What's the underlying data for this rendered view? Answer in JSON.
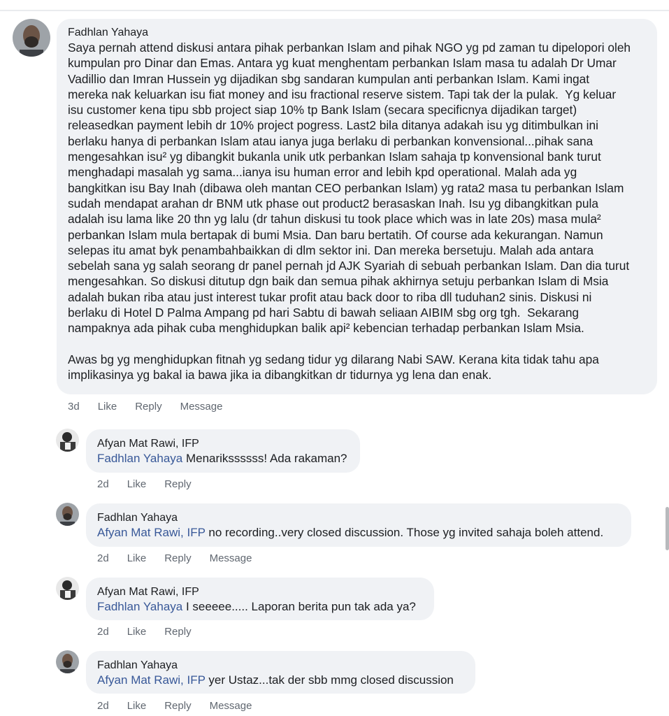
{
  "main_comment": {
    "author": "Fadhlan Yahaya",
    "lines": [
      "Saya pernah attend diskusi antara pihak perbankan Islam and pihak NGO yg pd zaman tu dipelopori oleh",
      "kumpulan pro Dinar dan Emas. Antara yg kuat menghentam perbankan Islam masa tu adalah Dr Umar",
      "Vadillio dan Imran Hussein yg dijadikan sbg sandaran kumpulan anti perbankan Islam. Kami ingat",
      "mereka nak keluarkan isu fiat money and isu fractional reserve sistem. Tapi tak der la pulak.  Yg keluar",
      "isu customer kena tipu sbb project siap 10% tp Bank Islam (secara specificnya dijadikan target)",
      "releasedkan payment lebih dr 10% project pogress. Last2 bila ditanya adakah isu yg ditimbulkan ini",
      "berlaku hanya di perbankan Islam atau ianya juga berlaku di perbankan konvensional...pihak sana",
      "mengesahkan isu² yg dibangkit bukanla unik utk perbankan Islam sahaja tp konvensional bank turut",
      "menghadapi masalah yg sama...ianya isu human error and lebih kpd operational. Malah ada yg",
      "bangkitkan isu Bay Inah (dibawa oleh mantan CEO perbankan Islam) yg rata2 masa tu perbankan Islam",
      "sudah mendapat arahan dr BNM utk phase out product2 berasaskan Inah. Isu yg dibangkitkan pula",
      "adalah isu lama like 20 thn yg lalu (dr tahun diskusi tu took place which was in late 20s) masa mula²",
      "perbankan Islam mula bertapak di bumi Msia. Dan baru bertatih. Of course ada kekurangan. Namun",
      "selepas itu amat byk penambahbaikkan di dlm sektor ini. Dan mereka bersetuju. Malah ada antara",
      "sebelah sana yg salah seorang dr panel pernah jd AJK Syariah di sebuah perbankan Islam. Dan dia turut",
      "mengesahkan. So diskusi ditutup dgn baik dan semua pihak akhirnya setuju perbankan Islam di Msia",
      "adalah bukan riba atau just interest tukar profit atau back door to riba dll tuduhan2 sinis. Diskusi ni",
      "berlaku di Hotel D Palma Ampang pd hari Sabtu di bawah seliaan AIBIM sbg org tgh.  Sekarang",
      "nampaknya ada pihak cuba menghidupkan balik api² kebencian terhadap perbankan Islam Msia.",
      "",
      "Awas bg yg menghidupkan fitnah yg sedang tidur yg dilarang Nabi SAW. Kerana kita tidak tahu apa",
      "implikasinya yg bakal ia bawa jika ia dibangkitkan dr tidurnya yg lena dan enak."
    ],
    "time": "3d",
    "like": "Like",
    "reply": "Reply",
    "message": "Message"
  },
  "replies": [
    {
      "author": "Afyan Mat Rawi, IFP",
      "mention": "Fadhlan Yahaya",
      "text": " Menarikssssss! Ada rakaman?",
      "time": "2d",
      "like": "Like",
      "reply": "Reply"
    },
    {
      "author": "Fadhlan Yahaya",
      "mention": "Afyan Mat Rawi, IFP",
      "text": " no recording..very closed discussion. Those yg invited sahaja boleh attend.",
      "time": "2d",
      "like": "Like",
      "reply": "Reply",
      "message": "Message"
    },
    {
      "author": "Afyan Mat Rawi, IFP",
      "mention": "Fadhlan Yahaya",
      "text": " I seeeee..... Laporan berita pun tak ada ya?",
      "time": "2d",
      "like": "Like",
      "reply": "Reply"
    },
    {
      "author": "Fadhlan Yahaya",
      "mention": "Afyan Mat Rawi, IFP",
      "text": " yer Ustaz...tak der sbb mmg closed discussion",
      "time": "2d",
      "like": "Like",
      "reply": "Reply",
      "message": "Message"
    }
  ],
  "colors": {
    "bubble": "#f0f2f5",
    "mention": "#385898",
    "meta": "#606770"
  }
}
